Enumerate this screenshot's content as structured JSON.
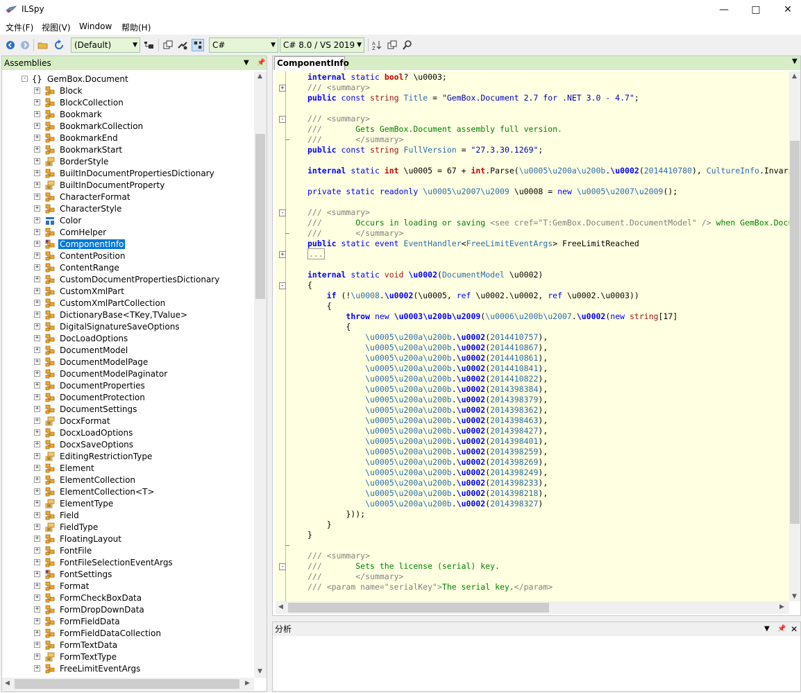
{
  "window": {
    "title": "ILSpy"
  },
  "menu": [
    "文件(F)",
    "视图(V)",
    "Window",
    "帮助(H)"
  ],
  "toolbar": {
    "assembly_list": "(Default)",
    "language": "C#",
    "language_version": "C# 8.0 / VS 2019"
  },
  "assemblies": {
    "header": "Assemblies",
    "namespace": "GemBox.Document",
    "items": [
      {
        "label": "Block",
        "icon": "class"
      },
      {
        "label": "BlockCollection",
        "icon": "class"
      },
      {
        "label": "Bookmark",
        "icon": "class"
      },
      {
        "label": "BookmarkCollection",
        "icon": "class"
      },
      {
        "label": "BookmarkEnd",
        "icon": "class"
      },
      {
        "label": "BookmarkStart",
        "icon": "class"
      },
      {
        "label": "BorderStyle",
        "icon": "enum"
      },
      {
        "label": "BuiltInDocumentPropertiesDictionary",
        "icon": "class"
      },
      {
        "label": "BuiltInDocumentProperty",
        "icon": "enum"
      },
      {
        "label": "CharacterFormat",
        "icon": "class"
      },
      {
        "label": "CharacterStyle",
        "icon": "class"
      },
      {
        "label": "Color",
        "icon": "struct"
      },
      {
        "label": "ComHelper",
        "icon": "class"
      },
      {
        "label": "ComponentInfo",
        "icon": "static-class",
        "selected": true
      },
      {
        "label": "ContentPosition",
        "icon": "class"
      },
      {
        "label": "ContentRange",
        "icon": "class"
      },
      {
        "label": "CustomDocumentPropertiesDictionary",
        "icon": "class"
      },
      {
        "label": "CustomXmlPart",
        "icon": "class"
      },
      {
        "label": "CustomXmlPartCollection",
        "icon": "class"
      },
      {
        "label": "DictionaryBase<TKey,TValue>",
        "icon": "class"
      },
      {
        "label": "DigitalSignatureSaveOptions",
        "icon": "class"
      },
      {
        "label": "DocLoadOptions",
        "icon": "class"
      },
      {
        "label": "DocumentModel",
        "icon": "class"
      },
      {
        "label": "DocumentModelPage",
        "icon": "class"
      },
      {
        "label": "DocumentModelPaginator",
        "icon": "class"
      },
      {
        "label": "DocumentProperties",
        "icon": "class"
      },
      {
        "label": "DocumentProtection",
        "icon": "class"
      },
      {
        "label": "DocumentSettings",
        "icon": "class"
      },
      {
        "label": "DocxFormat",
        "icon": "enum"
      },
      {
        "label": "DocxLoadOptions",
        "icon": "class"
      },
      {
        "label": "DocxSaveOptions",
        "icon": "class"
      },
      {
        "label": "EditingRestrictionType",
        "icon": "enum"
      },
      {
        "label": "Element",
        "icon": "class"
      },
      {
        "label": "ElementCollection",
        "icon": "class"
      },
      {
        "label": "ElementCollection<T>",
        "icon": "class"
      },
      {
        "label": "ElementType",
        "icon": "enum"
      },
      {
        "label": "Field",
        "icon": "class"
      },
      {
        "label": "FieldType",
        "icon": "enum"
      },
      {
        "label": "FloatingLayout",
        "icon": "class"
      },
      {
        "label": "FontFile",
        "icon": "class"
      },
      {
        "label": "FontFileSelectionEventArgs",
        "icon": "class"
      },
      {
        "label": "FontSettings",
        "icon": "static-class"
      },
      {
        "label": "Format",
        "icon": "class"
      },
      {
        "label": "FormCheckBoxData",
        "icon": "class"
      },
      {
        "label": "FormDropDownData",
        "icon": "class"
      },
      {
        "label": "FormFieldData",
        "icon": "class"
      },
      {
        "label": "FormFieldDataCollection",
        "icon": "class"
      },
      {
        "label": "FormTextData",
        "icon": "class"
      },
      {
        "label": "FormTextType",
        "icon": "enum"
      },
      {
        "label": "FreeLimitEventArgs",
        "icon": "class"
      }
    ]
  },
  "editor": {
    "tab_label": "ComponentInfo",
    "lines": [
      [
        [
          "kw",
          "internal"
        ],
        [
          "",
          " "
        ],
        [
          "kw2",
          "static"
        ],
        [
          "",
          " "
        ],
        [
          "vt",
          "bool"
        ],
        [
          "",
          "? \\u0003;"
        ]
      ],
      [
        [
          "doc",
          "/// "
        ],
        [
          "doc",
          "<summary>"
        ]
      ],
      [
        [
          "kw",
          "public"
        ],
        [
          "",
          " "
        ],
        [
          "kw2",
          "const"
        ],
        [
          "",
          " "
        ],
        [
          "rd",
          "string"
        ],
        [
          "",
          " "
        ],
        [
          "ty",
          "Title"
        ],
        [
          "",
          " = "
        ],
        [
          "str",
          "\"GemBox.Document 2.7 for .NET 3.0 - 4.7\""
        ],
        [
          "",
          ";"
        ]
      ],
      [],
      [
        [
          "doc",
          "/// "
        ],
        [
          "doc",
          "<summary>"
        ]
      ],
      [
        [
          "doc",
          "///"
        ],
        [
          "cm",
          "       Gets GemBox.Document assembly full version."
        ]
      ],
      [
        [
          "doc",
          "///"
        ],
        [
          "doc",
          "       </summary>"
        ]
      ],
      [
        [
          "kw",
          "public"
        ],
        [
          "",
          " "
        ],
        [
          "kw2",
          "const"
        ],
        [
          "",
          " "
        ],
        [
          "rd",
          "string"
        ],
        [
          "",
          " "
        ],
        [
          "ty",
          "FullVersion"
        ],
        [
          "",
          " = "
        ],
        [
          "str",
          "\"27.3.30.1269\""
        ],
        [
          "",
          ";"
        ]
      ],
      [],
      [
        [
          "kw",
          "internal"
        ],
        [
          "",
          " "
        ],
        [
          "kw2",
          "static"
        ],
        [
          "",
          " "
        ],
        [
          "vt",
          "int"
        ],
        [
          "",
          " \\u0005 = 67 + "
        ],
        [
          "vt",
          "int"
        ],
        [
          "",
          ".Parse("
        ],
        [
          "ty",
          "\\u0005\\u200a\\u200b"
        ],
        [
          "",
          "."
        ],
        [
          "kw",
          "\\u0002"
        ],
        [
          "",
          "("
        ],
        [
          "ty",
          "2014410780"
        ],
        [
          "",
          "), "
        ],
        [
          "ty",
          "CultureInfo"
        ],
        [
          "",
          ".Invariant"
        ]
      ],
      [],
      [
        [
          "kw2",
          "private"
        ],
        [
          "",
          " "
        ],
        [
          "kw2",
          "static"
        ],
        [
          "",
          " "
        ],
        [
          "kw2",
          "readonly"
        ],
        [
          "",
          " "
        ],
        [
          "ty",
          "\\u0005\\u2007\\u2009"
        ],
        [
          "",
          " \\u0008 = "
        ],
        [
          "kw2",
          "new"
        ],
        [
          "",
          " "
        ],
        [
          "ty",
          "\\u0005\\u2007\\u2009"
        ],
        [
          "",
          "();"
        ]
      ],
      [],
      [
        [
          "doc",
          "/// "
        ],
        [
          "doc",
          "<summary>"
        ]
      ],
      [
        [
          "doc",
          "///"
        ],
        [
          "cm",
          "       Occurs in loading or saving "
        ],
        [
          "doc",
          "<see cref="
        ],
        [
          "doc",
          "\"T:GemBox.Document.DocumentModel\""
        ],
        [
          "doc",
          " /> "
        ],
        [
          "cm",
          "when GemBox.Document"
        ]
      ],
      [
        [
          "doc",
          "///"
        ],
        [
          "doc",
          "       </summary>"
        ]
      ],
      [
        [
          "kw",
          "public"
        ],
        [
          "",
          " "
        ],
        [
          "kw2",
          "static"
        ],
        [
          "",
          " "
        ],
        [
          "kw2",
          "event"
        ],
        [
          "",
          " "
        ],
        [
          "ty",
          "EventHandler"
        ],
        [
          "",
          "<"
        ],
        [
          "ty",
          "FreeLimitEventArgs"
        ],
        [
          "",
          "> FreeLimitReached"
        ]
      ],
      [
        [
          "doc",
          "..."
        ]
      ],
      [],
      [
        [
          "kw",
          "internal"
        ],
        [
          "",
          " "
        ],
        [
          "kw2",
          "static"
        ],
        [
          "",
          " "
        ],
        [
          "rd",
          "void"
        ],
        [
          "",
          " "
        ],
        [
          "kw",
          "\\u0002"
        ],
        [
          "",
          "("
        ],
        [
          "ty",
          "DocumentModel"
        ],
        [
          "",
          " \\u0002)"
        ]
      ],
      [
        [
          "",
          "{"
        ]
      ],
      [
        [
          "",
          "    "
        ],
        [
          "kw",
          "if"
        ],
        [
          "",
          " (!"
        ],
        [
          "ty",
          "\\u0008"
        ],
        [
          "",
          "."
        ],
        [
          "kw",
          "\\u0002"
        ],
        [
          "",
          "(\\u0005, "
        ],
        [
          "kw2",
          "ref"
        ],
        [
          "",
          " \\u0002.\\u0002, "
        ],
        [
          "kw2",
          "ref"
        ],
        [
          "",
          " \\u0002.\\u0003))"
        ]
      ],
      [
        [
          "",
          "    {"
        ]
      ],
      [
        [
          "",
          "        "
        ],
        [
          "kw",
          "throw"
        ],
        [
          "",
          " "
        ],
        [
          "kw2",
          "new"
        ],
        [
          "",
          " "
        ],
        [
          "kw",
          "\\u0003\\u200b\\u2009"
        ],
        [
          "",
          "("
        ],
        [
          "ty",
          "\\u0006\\u200b\\u2007"
        ],
        [
          "",
          "."
        ],
        [
          "kw",
          "\\u0002"
        ],
        [
          "",
          "("
        ],
        [
          "kw2",
          "new"
        ],
        [
          "",
          " "
        ],
        [
          "rd",
          "string"
        ],
        [
          "",
          "[17]"
        ]
      ],
      [
        [
          "",
          "        {"
        ]
      ],
      [
        [
          "",
          "            "
        ],
        [
          "ty",
          "\\u0005\\u200a\\u200b"
        ],
        [
          "",
          "."
        ],
        [
          "kw",
          "\\u0002"
        ],
        [
          "",
          "("
        ],
        [
          "ty",
          "2014410757"
        ],
        [
          "",
          "),"
        ]
      ],
      [
        [
          "",
          "            "
        ],
        [
          "ty",
          "\\u0005\\u200a\\u200b"
        ],
        [
          "",
          "."
        ],
        [
          "kw",
          "\\u0002"
        ],
        [
          "",
          "("
        ],
        [
          "ty",
          "2014410867"
        ],
        [
          "",
          "),"
        ]
      ],
      [
        [
          "",
          "            "
        ],
        [
          "ty",
          "\\u0005\\u200a\\u200b"
        ],
        [
          "",
          "."
        ],
        [
          "kw",
          "\\u0002"
        ],
        [
          "",
          "("
        ],
        [
          "ty",
          "2014410861"
        ],
        [
          "",
          "),"
        ]
      ],
      [
        [
          "",
          "            "
        ],
        [
          "ty",
          "\\u0005\\u200a\\u200b"
        ],
        [
          "",
          "."
        ],
        [
          "kw",
          "\\u0002"
        ],
        [
          "",
          "("
        ],
        [
          "ty",
          "2014410841"
        ],
        [
          "",
          "),"
        ]
      ],
      [
        [
          "",
          "            "
        ],
        [
          "ty",
          "\\u0005\\u200a\\u200b"
        ],
        [
          "",
          "."
        ],
        [
          "kw",
          "\\u0002"
        ],
        [
          "",
          "("
        ],
        [
          "ty",
          "2014410822"
        ],
        [
          "",
          "),"
        ]
      ],
      [
        [
          "",
          "            "
        ],
        [
          "ty",
          "\\u0005\\u200a\\u200b"
        ],
        [
          "",
          "."
        ],
        [
          "kw",
          "\\u0002"
        ],
        [
          "",
          "("
        ],
        [
          "ty",
          "2014398384"
        ],
        [
          "",
          "),"
        ]
      ],
      [
        [
          "",
          "            "
        ],
        [
          "ty",
          "\\u0005\\u200a\\u200b"
        ],
        [
          "",
          "."
        ],
        [
          "kw",
          "\\u0002"
        ],
        [
          "",
          "("
        ],
        [
          "ty",
          "2014398379"
        ],
        [
          "",
          "),"
        ]
      ],
      [
        [
          "",
          "            "
        ],
        [
          "ty",
          "\\u0005\\u200a\\u200b"
        ],
        [
          "",
          "."
        ],
        [
          "kw",
          "\\u0002"
        ],
        [
          "",
          "("
        ],
        [
          "ty",
          "2014398362"
        ],
        [
          "",
          "),"
        ]
      ],
      [
        [
          "",
          "            "
        ],
        [
          "ty",
          "\\u0005\\u200a\\u200b"
        ],
        [
          "",
          "."
        ],
        [
          "kw",
          "\\u0002"
        ],
        [
          "",
          "("
        ],
        [
          "ty",
          "2014398463"
        ],
        [
          "",
          "),"
        ]
      ],
      [
        [
          "",
          "            "
        ],
        [
          "ty",
          "\\u0005\\u200a\\u200b"
        ],
        [
          "",
          "."
        ],
        [
          "kw",
          "\\u0002"
        ],
        [
          "",
          "("
        ],
        [
          "ty",
          "2014398427"
        ],
        [
          "",
          "),"
        ]
      ],
      [
        [
          "",
          "            "
        ],
        [
          "ty",
          "\\u0005\\u200a\\u200b"
        ],
        [
          "",
          "."
        ],
        [
          "kw",
          "\\u0002"
        ],
        [
          "",
          "("
        ],
        [
          "ty",
          "2014398401"
        ],
        [
          "",
          "),"
        ]
      ],
      [
        [
          "",
          "            "
        ],
        [
          "ty",
          "\\u0005\\u200a\\u200b"
        ],
        [
          "",
          "."
        ],
        [
          "kw",
          "\\u0002"
        ],
        [
          "",
          "("
        ],
        [
          "ty",
          "2014398259"
        ],
        [
          "",
          "),"
        ]
      ],
      [
        [
          "",
          "            "
        ],
        [
          "ty",
          "\\u0005\\u200a\\u200b"
        ],
        [
          "",
          "."
        ],
        [
          "kw",
          "\\u0002"
        ],
        [
          "",
          "("
        ],
        [
          "ty",
          "2014398269"
        ],
        [
          "",
          "),"
        ]
      ],
      [
        [
          "",
          "            "
        ],
        [
          "ty",
          "\\u0005\\u200a\\u200b"
        ],
        [
          "",
          "."
        ],
        [
          "kw",
          "\\u0002"
        ],
        [
          "",
          "("
        ],
        [
          "ty",
          "2014398249"
        ],
        [
          "",
          "),"
        ]
      ],
      [
        [
          "",
          "            "
        ],
        [
          "ty",
          "\\u0005\\u200a\\u200b"
        ],
        [
          "",
          "."
        ],
        [
          "kw",
          "\\u0002"
        ],
        [
          "",
          "("
        ],
        [
          "ty",
          "2014398233"
        ],
        [
          "",
          "),"
        ]
      ],
      [
        [
          "",
          "            "
        ],
        [
          "ty",
          "\\u0005\\u200a\\u200b"
        ],
        [
          "",
          "."
        ],
        [
          "kw",
          "\\u0002"
        ],
        [
          "",
          "("
        ],
        [
          "ty",
          "2014398218"
        ],
        [
          "",
          "),"
        ]
      ],
      [
        [
          "",
          "            "
        ],
        [
          "ty",
          "\\u0005\\u200a\\u200b"
        ],
        [
          "",
          "."
        ],
        [
          "kw",
          "\\u0002"
        ],
        [
          "",
          "("
        ],
        [
          "ty",
          "2014398327"
        ],
        [
          "",
          ")"
        ]
      ],
      [
        [
          "",
          "        }));"
        ]
      ],
      [
        [
          "",
          "    }"
        ]
      ],
      [
        [
          "",
          "}"
        ]
      ],
      [],
      [
        [
          "doc",
          "/// "
        ],
        [
          "doc",
          "<summary>"
        ]
      ],
      [
        [
          "doc",
          "///"
        ],
        [
          "cm",
          "       Sets the license (serial) key."
        ]
      ],
      [
        [
          "doc",
          "///"
        ],
        [
          "doc",
          "       </summary>"
        ]
      ],
      [
        [
          "doc",
          "/// "
        ],
        [
          "doc",
          "<param name="
        ],
        [
          "doc",
          "\"serialKey\""
        ],
        [
          "doc",
          ">"
        ],
        [
          "cm",
          "The serial key."
        ],
        [
          "doc",
          "</param>"
        ]
      ]
    ]
  },
  "analyze": {
    "header": "分析"
  }
}
